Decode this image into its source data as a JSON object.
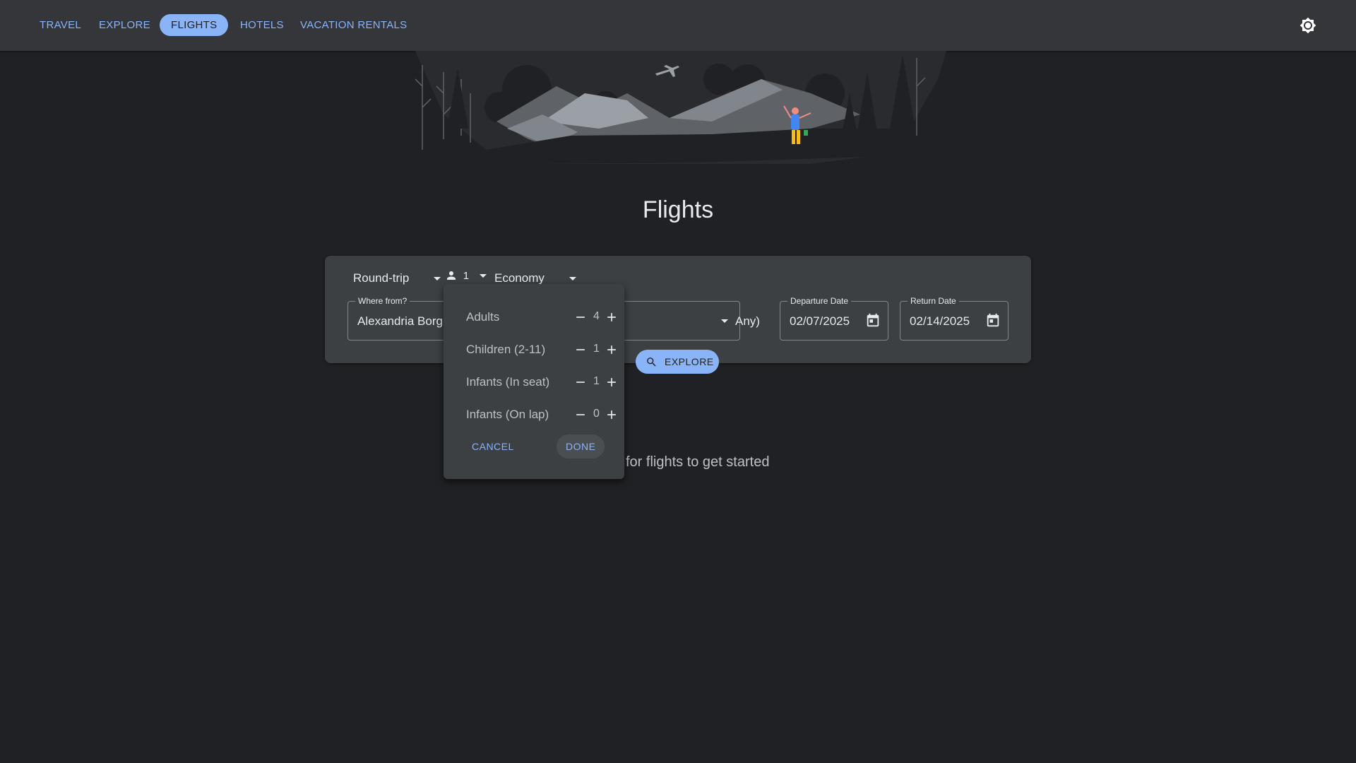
{
  "nav": {
    "tabs": [
      {
        "label": "TRAVEL"
      },
      {
        "label": "EXPLORE"
      },
      {
        "label": "FLIGHTS"
      },
      {
        "label": "HOTELS"
      },
      {
        "label": "VACATION RENTALS"
      }
    ],
    "active_tab": "FLIGHTS",
    "theme_toggle_icon": "brightness-icon"
  },
  "page": {
    "title": "Flights"
  },
  "search": {
    "trip_type": "Round-trip",
    "passenger_count": "1",
    "cabin_class": "Economy",
    "from": {
      "label": "Where from?",
      "value": "Alexandria Borg I"
    },
    "to": {
      "value_partial": "Any)"
    },
    "departure": {
      "label": "Departure Date",
      "value": "02/07/2025"
    },
    "return": {
      "label": "Return Date",
      "value": "02/14/2025"
    },
    "explore_label": "EXPLORE"
  },
  "passengers_popup": {
    "rows": [
      {
        "label": "Adults",
        "count": "4"
      },
      {
        "label": "Children (2-11)",
        "count": "1"
      },
      {
        "label": "Infants (In seat)",
        "count": "1"
      },
      {
        "label": "Infants (On lap)",
        "count": "0"
      }
    ],
    "cancel_label": "CANCEL",
    "done_label": "DONE"
  },
  "empty_state": {
    "text": "for flights to get started"
  },
  "colors": {
    "accent": "#8ab4f8",
    "background": "#202124",
    "surface": "#3c4043",
    "topbar": "#35363a"
  }
}
